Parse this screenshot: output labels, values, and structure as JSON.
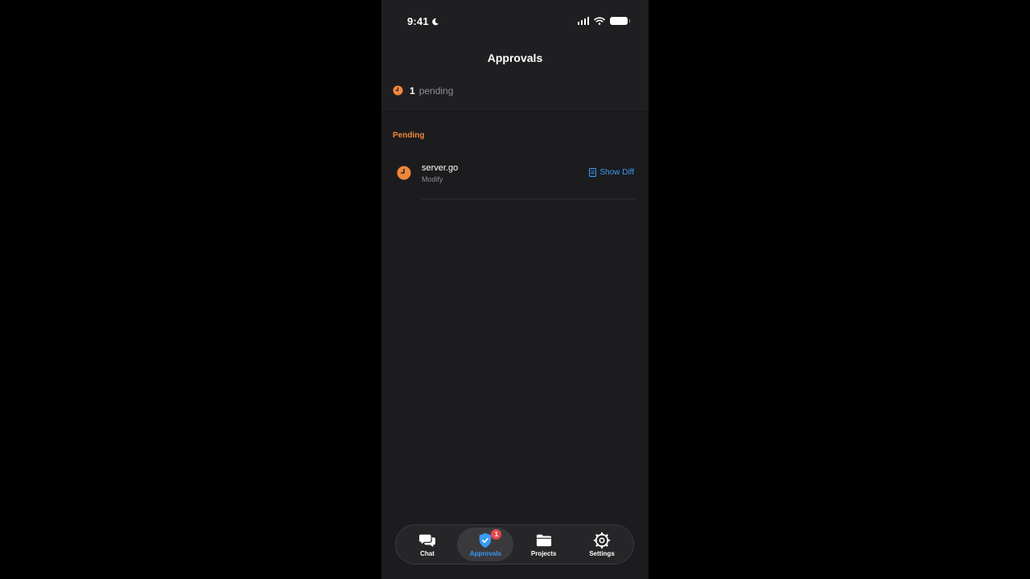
{
  "status_bar": {
    "time": "9:41"
  },
  "header": {
    "title": "Approvals"
  },
  "summary": {
    "count": "1",
    "label": "pending"
  },
  "section": {
    "title": "Pending"
  },
  "approvals": [
    {
      "file": "server.go",
      "action": "Modify",
      "button_label": "Show Diff"
    }
  ],
  "tabs": [
    {
      "label": "Chat",
      "icon": "chat-bubbles-icon",
      "active": false
    },
    {
      "label": "Approvals",
      "icon": "shield-check-icon",
      "active": true,
      "badge": "1"
    },
    {
      "label": "Projects",
      "icon": "folder-icon",
      "active": false
    },
    {
      "label": "Settings",
      "icon": "gear-icon",
      "active": false
    }
  ],
  "colors": {
    "accent": "#3a9af5",
    "pending": "#f0883e",
    "badge": "#e5484d",
    "background": "#1c1c1e"
  }
}
